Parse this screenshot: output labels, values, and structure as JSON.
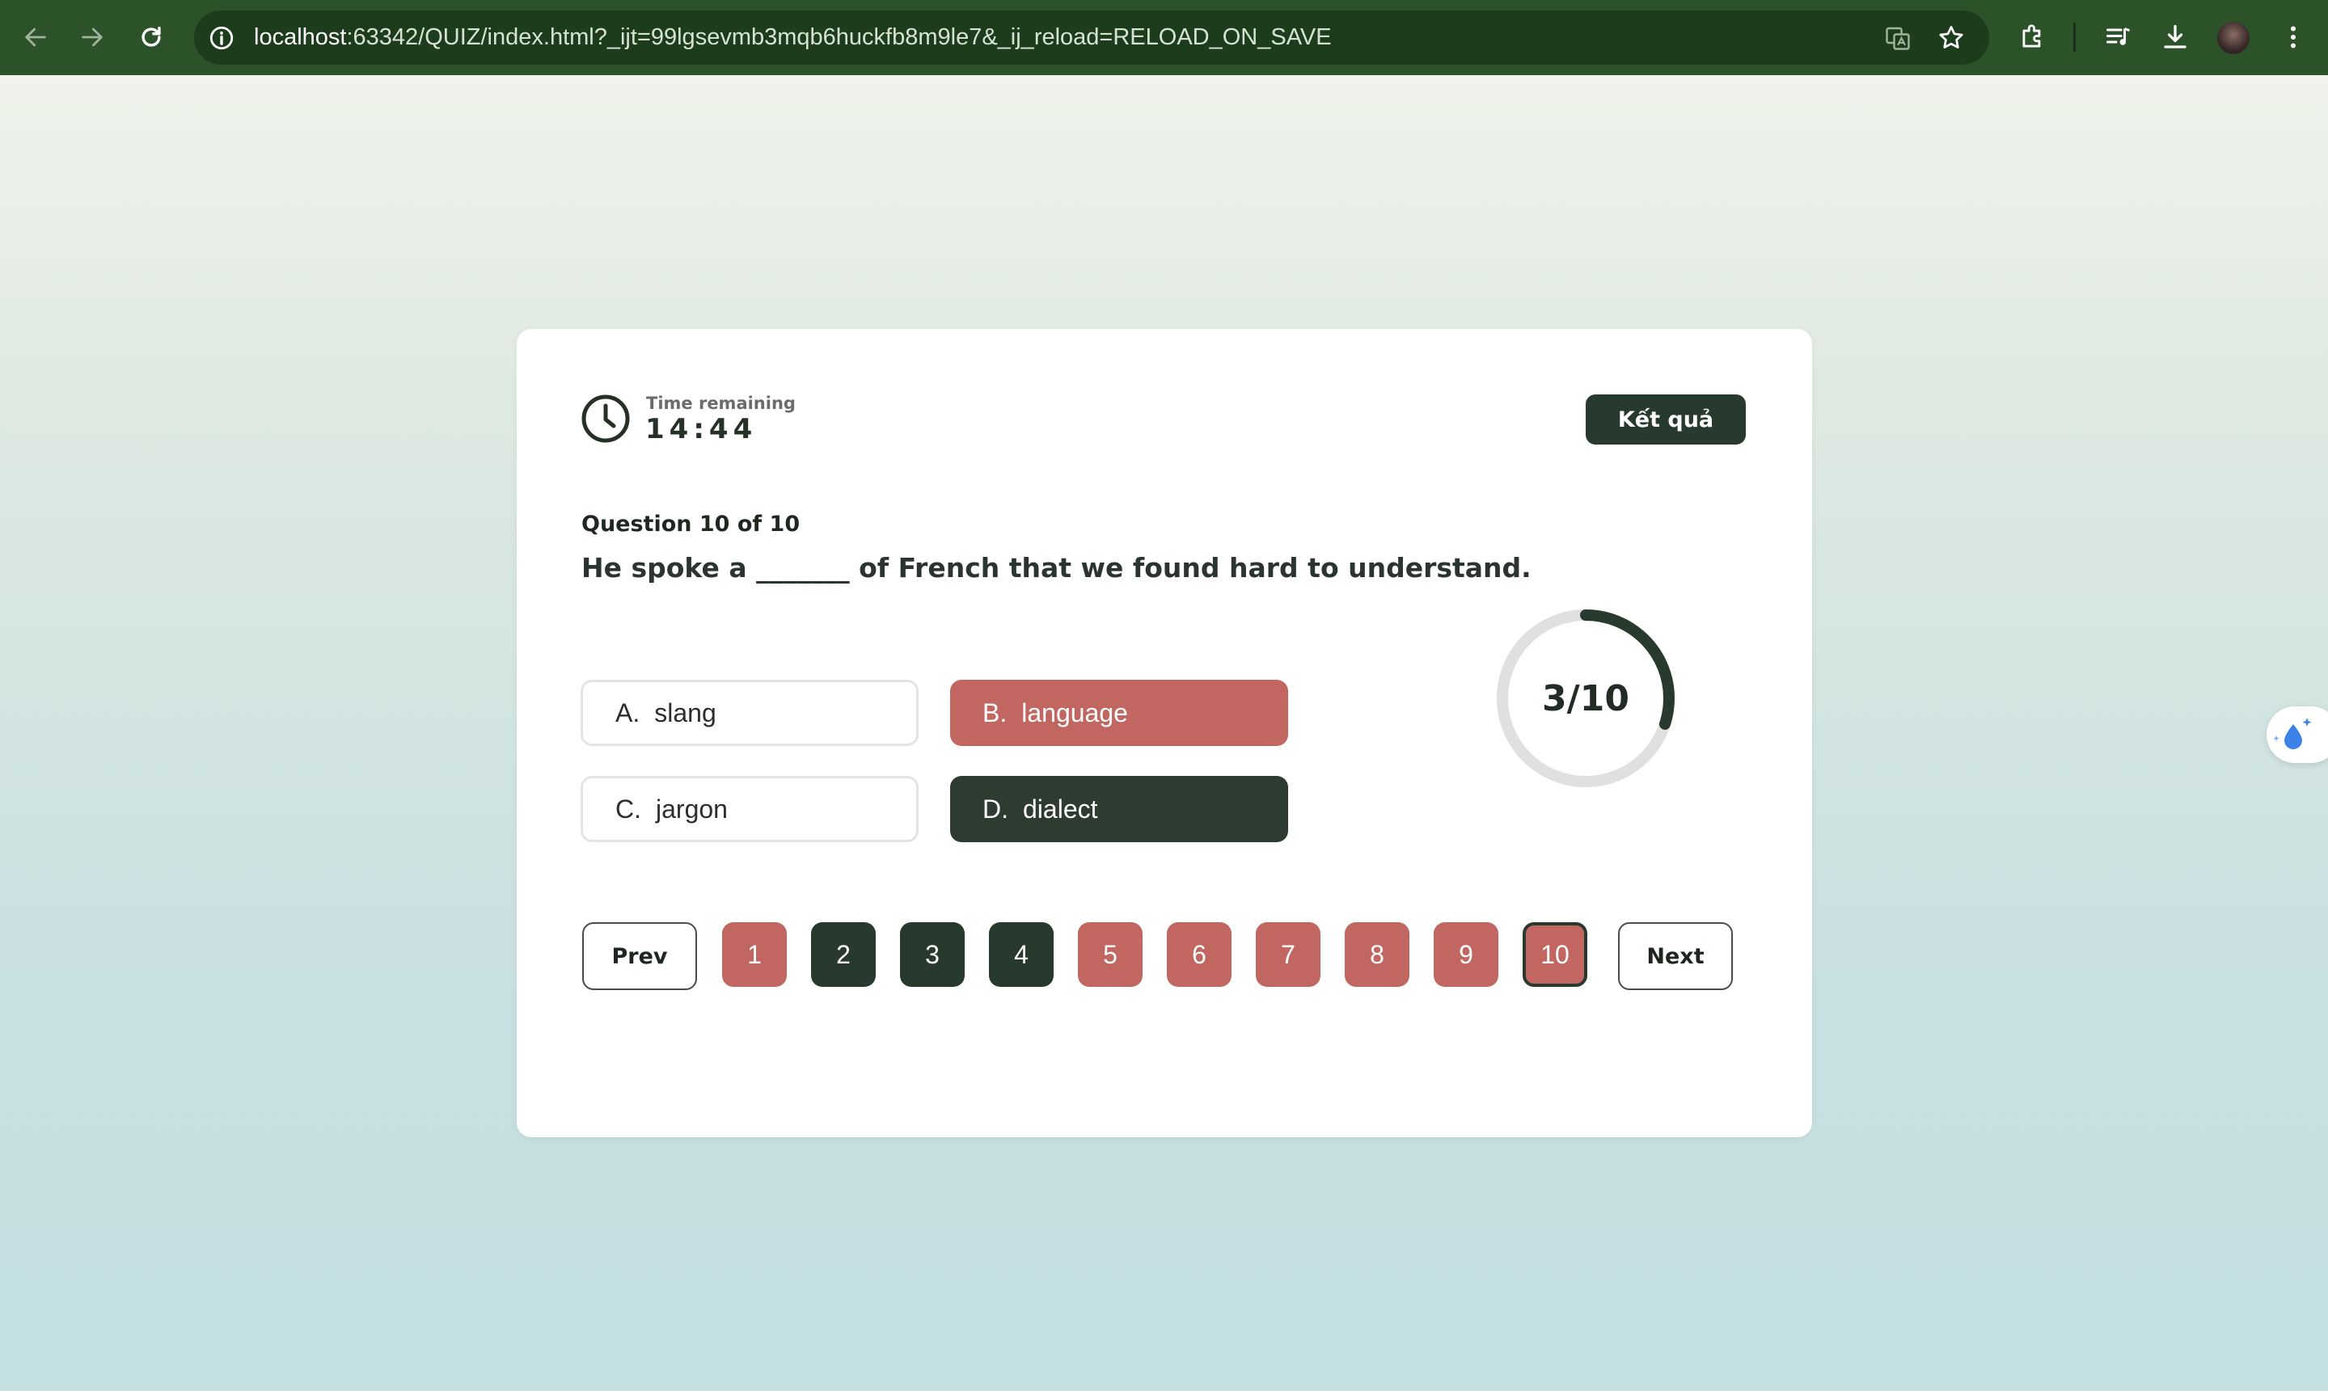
{
  "browser": {
    "url_host": "localhost",
    "url_rest": ":63342/QUIZ/index.html?_ijt=99lgsevmb3mqb6huckfb8m9le7&_ij_reload=RELOAD_ON_SAVE"
  },
  "timer": {
    "label": "Time remaining",
    "value": "14:44"
  },
  "result_button": "Kết quả",
  "question": {
    "counter": "Question 10 of 10",
    "text": "He spoke a _______ of French that we found hard to understand."
  },
  "options": [
    {
      "letter": "A.",
      "text": "slang",
      "state": "plain"
    },
    {
      "letter": "B.",
      "text": "language",
      "state": "wrong"
    },
    {
      "letter": "C.",
      "text": "jargon",
      "state": "plain"
    },
    {
      "letter": "D.",
      "text": "dialect",
      "state": "correct"
    }
  ],
  "score": {
    "label": "3/10",
    "correct": 3,
    "total": 10
  },
  "pager": {
    "prev": "Prev",
    "next": "Next",
    "pages": [
      {
        "label": "1",
        "state": "wrong"
      },
      {
        "label": "2",
        "state": "correct"
      },
      {
        "label": "3",
        "state": "correct"
      },
      {
        "label": "4",
        "state": "correct"
      },
      {
        "label": "5",
        "state": "wrong"
      },
      {
        "label": "6",
        "state": "wrong"
      },
      {
        "label": "7",
        "state": "wrong"
      },
      {
        "label": "8",
        "state": "wrong"
      },
      {
        "label": "9",
        "state": "wrong"
      },
      {
        "label": "10",
        "state": "wrong",
        "current": true
      }
    ]
  },
  "colors": {
    "accent_dark": "#283a2d",
    "wrong": "#c26662",
    "chrome": "#2b5229"
  }
}
